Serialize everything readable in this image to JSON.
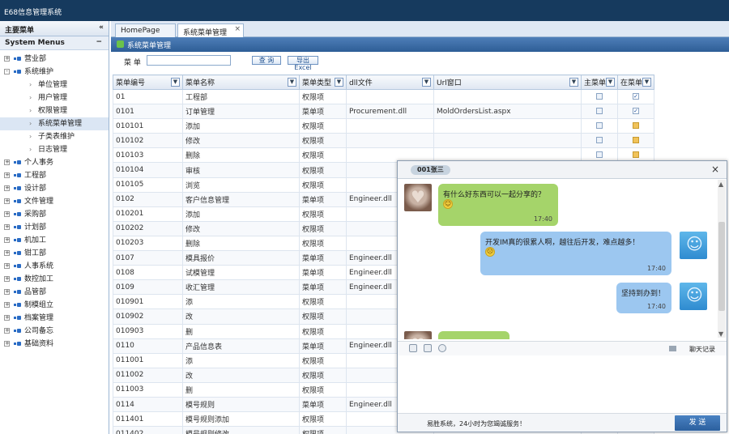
{
  "app": {
    "title": "E68信息管理系统"
  },
  "left": {
    "main_menu_label": "主要菜单",
    "system_menus_label": "System Menus",
    "tree": [
      {
        "label": "营业部",
        "level": 0,
        "toggle": "+"
      },
      {
        "label": "系统维护",
        "level": 0,
        "toggle": "-"
      },
      {
        "label": "单位管理",
        "level": 1
      },
      {
        "label": "用户管理",
        "level": 1
      },
      {
        "label": "权限管理",
        "level": 1
      },
      {
        "label": "系统菜单管理",
        "level": 1,
        "selected": true
      },
      {
        "label": "子类表维护",
        "level": 1
      },
      {
        "label": "日志管理",
        "level": 1
      },
      {
        "label": "个人事务",
        "level": 0,
        "toggle": "+"
      },
      {
        "label": "工程部",
        "level": 0,
        "toggle": "+"
      },
      {
        "label": "设计部",
        "level": 0,
        "toggle": "+"
      },
      {
        "label": "文件管理",
        "level": 0,
        "toggle": "+"
      },
      {
        "label": "采购部",
        "level": 0,
        "toggle": "+"
      },
      {
        "label": "计划部",
        "level": 0,
        "toggle": "+"
      },
      {
        "label": "机加工",
        "level": 0,
        "toggle": "+"
      },
      {
        "label": "钳工部",
        "level": 0,
        "toggle": "+"
      },
      {
        "label": "人事系统",
        "level": 0,
        "toggle": "+"
      },
      {
        "label": "数控加工",
        "level": 0,
        "toggle": "+"
      },
      {
        "label": "品管部",
        "level": 0,
        "toggle": "+"
      },
      {
        "label": "制模组立",
        "level": 0,
        "toggle": "+"
      },
      {
        "label": "档案管理",
        "level": 0,
        "toggle": "+"
      },
      {
        "label": "公司备忘",
        "level": 0,
        "toggle": "+"
      },
      {
        "label": "基础资料",
        "level": 0,
        "toggle": "+"
      }
    ]
  },
  "tabs": [
    {
      "label": "HomePage",
      "active": false
    },
    {
      "label": "系统菜单管理",
      "active": true,
      "close": "×"
    }
  ],
  "panel": {
    "title": "系统菜单管理"
  },
  "toolbar": {
    "menu_label": "菜 单",
    "query_button": "查 询",
    "export_button": "导出Excel"
  },
  "grid": {
    "columns": [
      "菜单编号",
      "菜单名称",
      "菜单类型",
      "dll文件",
      "Url窗口",
      "主菜单",
      "在菜单"
    ],
    "rows": [
      [
        "01",
        "工程部",
        "权限项",
        "",
        "",
        "off",
        "on"
      ],
      [
        "0101",
        "订单管理",
        "菜单项",
        "Procurement.dll",
        "MoldOrdersList.aspx",
        "off",
        "on"
      ],
      [
        "010101",
        "添加",
        "权限项",
        "",
        "",
        "off",
        "edit"
      ],
      [
        "010102",
        "修改",
        "权限项",
        "",
        "",
        "off",
        "edit"
      ],
      [
        "010103",
        "删除",
        "权限项",
        "",
        "",
        "off",
        "edit"
      ],
      [
        "010104",
        "审核",
        "权限项",
        "",
        "",
        "off",
        "edit"
      ],
      [
        "010105",
        "浏览",
        "权限项",
        "",
        "",
        "",
        ""
      ],
      [
        "0102",
        "客户信息管理",
        "菜单项",
        "Engineer.dll",
        "",
        "",
        ""
      ],
      [
        "010201",
        "添加",
        "权限项",
        "",
        "",
        "",
        ""
      ],
      [
        "010202",
        "修改",
        "权限项",
        "",
        "",
        "",
        ""
      ],
      [
        "010203",
        "删除",
        "权限项",
        "",
        "",
        "",
        ""
      ],
      [
        "0107",
        "模具报价",
        "菜单项",
        "Engineer.dll",
        "",
        "",
        ""
      ],
      [
        "0108",
        "试模管理",
        "菜单项",
        "Engineer.dll",
        "",
        "",
        ""
      ],
      [
        "0109",
        "收汇管理",
        "菜单项",
        "Engineer.dll",
        "",
        "",
        ""
      ],
      [
        "010901",
        "添",
        "权限项",
        "",
        "",
        "",
        ""
      ],
      [
        "010902",
        "改",
        "权限项",
        "",
        "",
        "",
        ""
      ],
      [
        "010903",
        "删",
        "权限项",
        "",
        "",
        "",
        ""
      ],
      [
        "0110",
        "产品信息表",
        "菜单项",
        "Engineer.dll",
        "",
        "",
        ""
      ],
      [
        "011001",
        "添",
        "权限项",
        "",
        "",
        "",
        ""
      ],
      [
        "011002",
        "改",
        "权限项",
        "",
        "",
        "",
        ""
      ],
      [
        "011003",
        "删",
        "权限项",
        "",
        "",
        "",
        ""
      ],
      [
        "0114",
        "模号规则",
        "菜单项",
        "Engineer.dll",
        "",
        "",
        ""
      ],
      [
        "011401",
        "模号规则添加",
        "权限项",
        "",
        "",
        "",
        ""
      ],
      [
        "011402",
        "模号规则修改",
        "权限项",
        "",
        "",
        "",
        ""
      ]
    ]
  },
  "chat": {
    "contact": "001张三",
    "close": "×",
    "messages": [
      {
        "side": "left",
        "text": "有什么好东西可以一起分享的？",
        "time": "17:40"
      },
      {
        "side": "right",
        "text": "开发IM真的很累人啊，越往后开发，难点越多！",
        "time": "17:40"
      },
      {
        "side": "right",
        "text": "坚持到办到！",
        "time": "17:40"
      }
    ],
    "history_label": "聊天记录",
    "footer_note": "易胜系统，24小时为您竭诚服务！",
    "send_button": "发 送"
  }
}
